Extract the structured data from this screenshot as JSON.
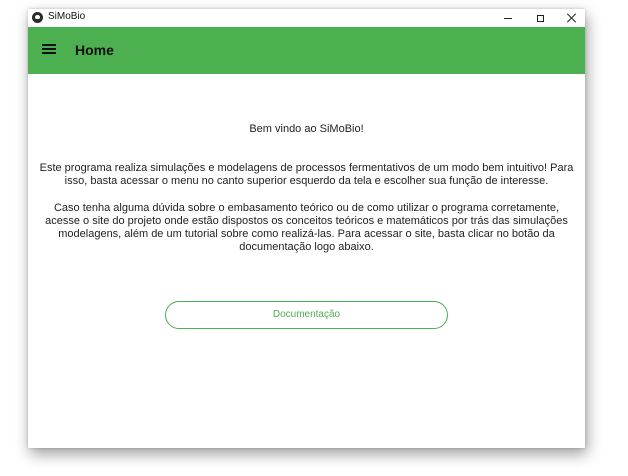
{
  "window": {
    "title": "SiMoBio",
    "controls": [
      "minimize",
      "maximize",
      "close"
    ]
  },
  "appbar": {
    "menu_icon": "hamburger-menu-icon",
    "title": "Home",
    "color": "#4caf50"
  },
  "content": {
    "welcome": "Bem vindo ao SiMoBio!",
    "paragraph1": "Este programa realiza simulações e modelagens de processos fermentativos de um modo bem intuitivo! Para isso, basta acessar o menu no canto superior esquerdo da tela e escolher sua função de interesse.",
    "paragraph2": "Caso tenha alguma dúvida sobre o embasamento teórico ou de como utilizar o programa corretamente, acesse o site do projeto onde estão dispostos os conceitos teóricos e matemáticos por trás das simulações modelagens, além de um tutorial sobre como realizá-las. Para acessar o site, basta clicar no botão da documentação logo abaixo.",
    "doc_button_label": "Documentação"
  }
}
